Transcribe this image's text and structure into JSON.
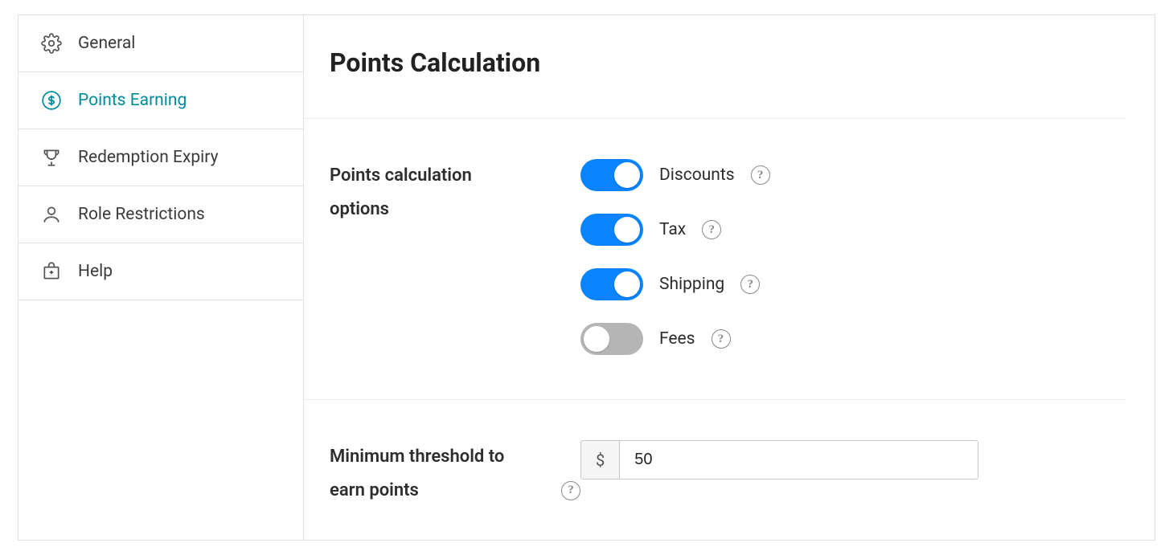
{
  "sidebar": {
    "items": [
      {
        "label": "General"
      },
      {
        "label": "Points Earning"
      },
      {
        "label": "Redemption Expiry"
      },
      {
        "label": "Role Restrictions"
      },
      {
        "label": "Help"
      }
    ]
  },
  "main": {
    "title": "Points Calculation",
    "options_label_l1": "Points calculation",
    "options_label_l2": "options",
    "toggles": [
      {
        "label": "Discounts",
        "on": true
      },
      {
        "label": "Tax",
        "on": true
      },
      {
        "label": "Shipping",
        "on": true
      },
      {
        "label": "Fees",
        "on": false
      }
    ],
    "threshold_label_l1": "Minimum threshold to",
    "threshold_label_l2": "earn points",
    "threshold_prefix": "$",
    "threshold_value": "50"
  }
}
